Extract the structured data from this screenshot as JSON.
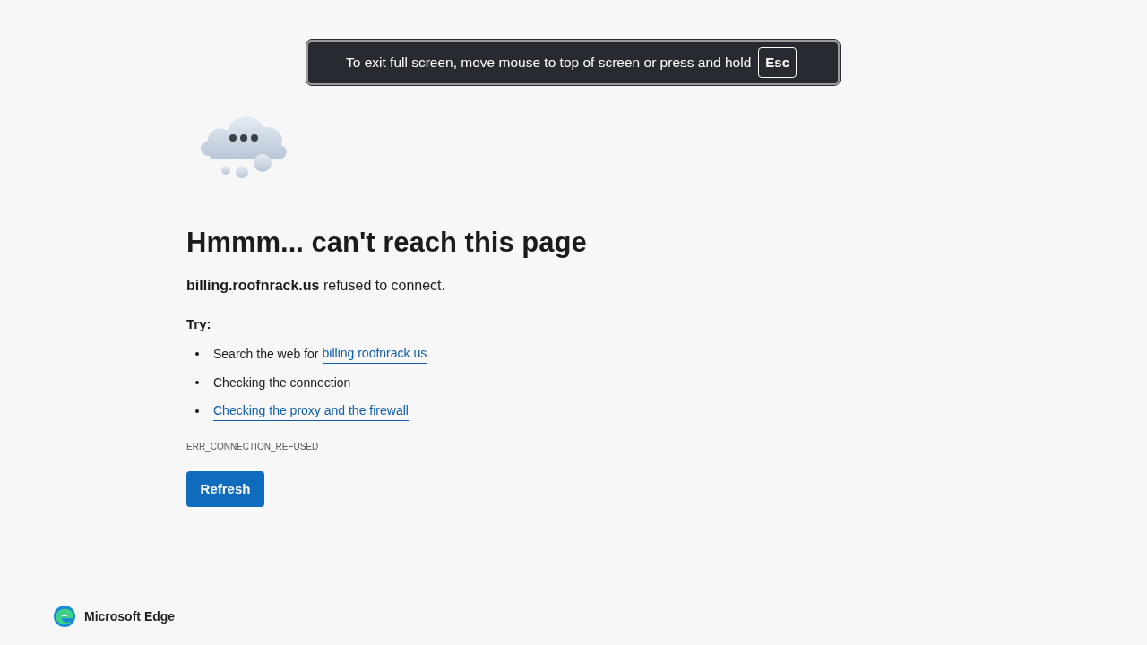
{
  "fullscreen_banner": {
    "message": "To exit full screen, move mouse to top of screen or press and hold",
    "key": "Esc"
  },
  "heading": "Hmmm... can't reach this page",
  "message": "**billing.roofnrack.us** refused to connect.",
  "try_label": "Try:",
  "suggestions": [
    {
      "text": "Search the web for",
      "link": "billing roofnrack us"
    },
    {
      "text": "Checking the connection"
    },
    {
      "link": "Checking the proxy and the firewall"
    }
  ],
  "error_code": "ERR_CONNECTION_REFUSED",
  "refresh_button": "Refresh",
  "footer": {
    "brand": "Microsoft Edge"
  }
}
